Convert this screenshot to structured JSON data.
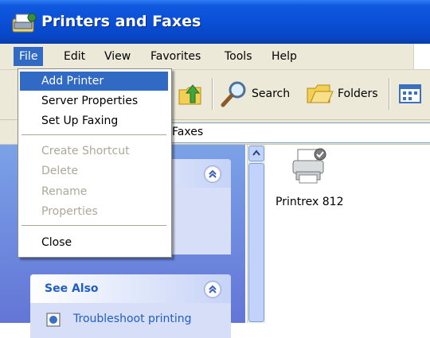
{
  "window": {
    "title": "Printers and Faxes"
  },
  "menubar": {
    "items": [
      {
        "label": "File"
      },
      {
        "label": "Edit"
      },
      {
        "label": "View"
      },
      {
        "label": "Favorites"
      },
      {
        "label": "Tools"
      },
      {
        "label": "Help"
      }
    ]
  },
  "toolbar": {
    "search_label": "Search",
    "folders_label": "Folders"
  },
  "address": {
    "value": "Faxes"
  },
  "file_menu": {
    "items": [
      {
        "label": "Add Printer",
        "state": "highlighted"
      },
      {
        "label": "Server Properties",
        "state": "enabled"
      },
      {
        "label": "Set Up Faxing",
        "state": "enabled"
      },
      {
        "label": "Create Shortcut",
        "state": "disabled"
      },
      {
        "label": "Delete",
        "state": "disabled"
      },
      {
        "label": "Rename",
        "state": "disabled"
      },
      {
        "label": "Properties",
        "state": "disabled"
      },
      {
        "label": "Close",
        "state": "enabled"
      }
    ]
  },
  "task_pane": {
    "see_also": {
      "title": "See Also",
      "link": "Troubleshoot printing"
    }
  },
  "printers": [
    {
      "name": "Printrex 812"
    }
  ],
  "colors": {
    "titlebar": "#0a4fd6",
    "menu_highlight": "#316ac5",
    "task_pane": "#6375d6",
    "link": "#215dc6"
  }
}
